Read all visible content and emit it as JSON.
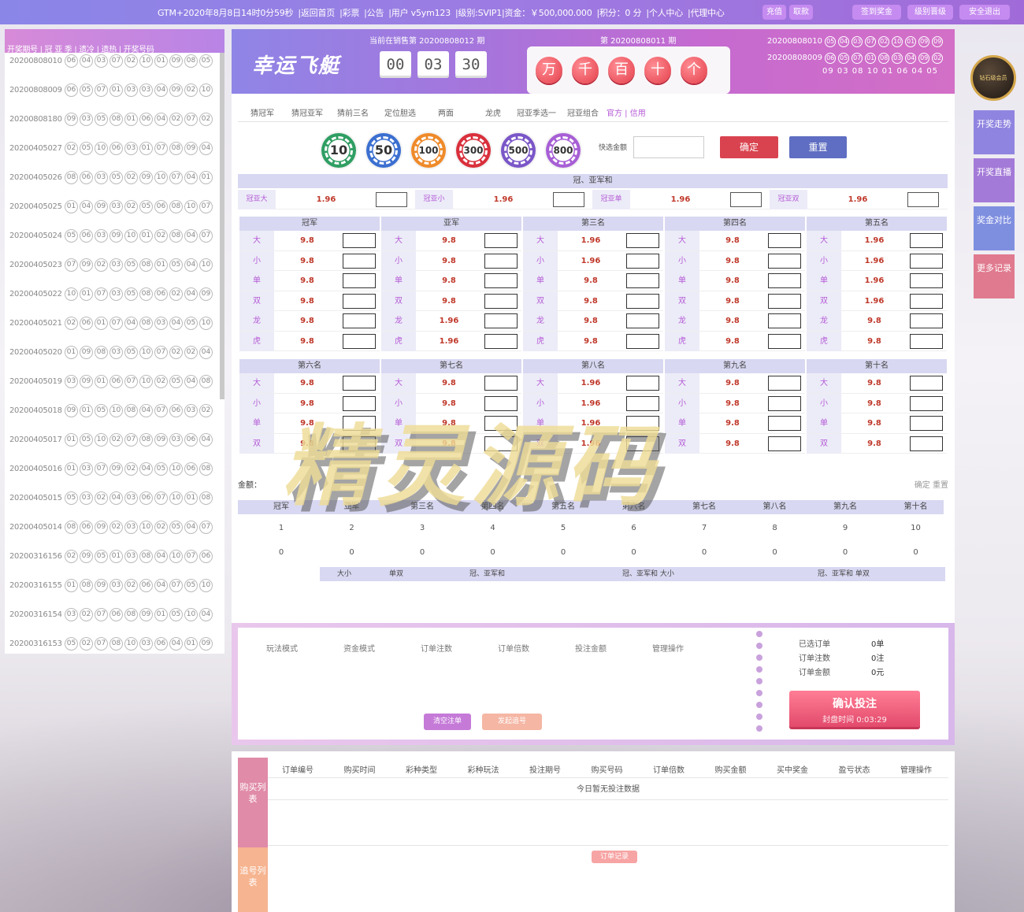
{
  "topbar": {
    "info": [
      "GTM+2020年8月8日14时0分59秒",
      "|返回首页",
      "|彩票",
      "|公告",
      "|用户 v5ym123",
      "|级别:SVIP1|资金：￥500,000.000",
      "|积分：0 分",
      "|个人中心",
      "|代理中心"
    ],
    "recharge": "充值",
    "withdraw": "取款",
    "btn_sign": "签到奖金",
    "btn_rank": "级别晋级",
    "btn_logout": "安全退出"
  },
  "left": {
    "header": "开奖期号 | 冠  亚  季 | 遗冷 | 遗热 |     开奖号码",
    "rows": [
      {
        "issue": "20200808010",
        "nums": [
          "06",
          "04",
          "03",
          "07",
          "02",
          "10",
          "01",
          "09",
          "08",
          "05"
        ]
      },
      {
        "issue": "20200808009",
        "nums": [
          "06",
          "05",
          "07",
          "01",
          "03",
          "03",
          "04",
          "09",
          "02",
          "10"
        ]
      },
      {
        "issue": "20200808180",
        "nums": [
          "09",
          "03",
          "05",
          "08",
          "01",
          "06",
          "04",
          "02",
          "07",
          "02"
        ]
      },
      {
        "issue": "20200405027",
        "nums": [
          "02",
          "05",
          "10",
          "06",
          "03",
          "01",
          "07",
          "08",
          "09",
          "04"
        ]
      },
      {
        "issue": "20200405026",
        "nums": [
          "08",
          "06",
          "03",
          "05",
          "02",
          "09",
          "10",
          "07",
          "04",
          "01"
        ]
      },
      {
        "issue": "20200405025",
        "nums": [
          "01",
          "04",
          "09",
          "03",
          "02",
          "05",
          "06",
          "08",
          "10",
          "07"
        ]
      },
      {
        "issue": "20200405024",
        "nums": [
          "05",
          "06",
          "03",
          "09",
          "10",
          "01",
          "02",
          "08",
          "04",
          "07"
        ]
      },
      {
        "issue": "20200405023",
        "nums": [
          "07",
          "09",
          "02",
          "03",
          "05",
          "08",
          "01",
          "05",
          "04",
          "10"
        ]
      },
      {
        "issue": "20200405022",
        "nums": [
          "10",
          "01",
          "07",
          "03",
          "05",
          "08",
          "06",
          "02",
          "04",
          "09"
        ]
      },
      {
        "issue": "20200405021",
        "nums": [
          "02",
          "06",
          "01",
          "07",
          "04",
          "08",
          "03",
          "04",
          "05",
          "10"
        ]
      },
      {
        "issue": "20200405020",
        "nums": [
          "01",
          "09",
          "08",
          "03",
          "05",
          "10",
          "07",
          "02",
          "02",
          "04"
        ]
      },
      {
        "issue": "20200405019",
        "nums": [
          "03",
          "09",
          "01",
          "06",
          "07",
          "10",
          "02",
          "05",
          "04",
          "08"
        ]
      },
      {
        "issue": "20200405018",
        "nums": [
          "09",
          "01",
          "05",
          "10",
          "08",
          "04",
          "07",
          "06",
          "03",
          "02"
        ]
      },
      {
        "issue": "20200405017",
        "nums": [
          "01",
          "05",
          "10",
          "02",
          "07",
          "08",
          "09",
          "03",
          "06",
          "04"
        ]
      },
      {
        "issue": "20200405016",
        "nums": [
          "01",
          "03",
          "07",
          "09",
          "02",
          "04",
          "05",
          "10",
          "06",
          "08"
        ]
      },
      {
        "issue": "20200405015",
        "nums": [
          "05",
          "03",
          "02",
          "04",
          "03",
          "06",
          "07",
          "10",
          "01",
          "08"
        ]
      },
      {
        "issue": "20200405014",
        "nums": [
          "08",
          "06",
          "09",
          "02",
          "03",
          "10",
          "02",
          "05",
          "04",
          "07"
        ]
      },
      {
        "issue": "20200316156",
        "nums": [
          "02",
          "09",
          "05",
          "01",
          "03",
          "08",
          "04",
          "10",
          "07",
          "06"
        ]
      },
      {
        "issue": "20200316155",
        "nums": [
          "01",
          "08",
          "09",
          "03",
          "02",
          "06",
          "04",
          "07",
          "05",
          "10"
        ]
      },
      {
        "issue": "20200316154",
        "nums": [
          "03",
          "02",
          "07",
          "06",
          "08",
          "09",
          "01",
          "05",
          "10",
          "04"
        ]
      },
      {
        "issue": "20200316153",
        "nums": [
          "05",
          "02",
          "07",
          "08",
          "10",
          "03",
          "06",
          "04",
          "01",
          "09"
        ]
      }
    ]
  },
  "banner": {
    "logo": "幸运飞艇",
    "current_title": "当前在销售第 20200808012 期",
    "timer": [
      "00",
      "03",
      "30"
    ],
    "last_title": "第 20200808011 期",
    "digits": [
      "万",
      "千",
      "百",
      "十",
      "个"
    ],
    "recent": [
      {
        "issue": "20200808010",
        "nums": [
          "05",
          "04",
          "03",
          "07",
          "02",
          "10",
          "01",
          "09",
          "09"
        ]
      },
      {
        "issue": "20200808009",
        "nums": [
          "06",
          "05",
          "07",
          "01",
          "08",
          "03",
          "04",
          "09",
          "02"
        ]
      }
    ],
    "tail": "09 03 08 10 01 06 04 05"
  },
  "tabs": [
    "猜冠军",
    "猜冠亚军",
    "猜前三名",
    "定位胆选",
    "两面",
    "龙虎",
    "冠亚季选一",
    "冠亚组合",
    "官方 | 信用"
  ],
  "chips": [
    {
      "label": "10",
      "color": "#2f9e63"
    },
    {
      "label": "50",
      "color": "#3b6fd0"
    },
    {
      "label": "100",
      "color": "#ef8a2a"
    },
    {
      "label": "300",
      "color": "#d9303c"
    },
    {
      "label": "500",
      "color": "#7a56c8"
    },
    {
      "label": "800",
      "color": "#a75fd5"
    }
  ],
  "quick": {
    "label": "快选金额",
    "ok": "确定",
    "reset": "重置"
  },
  "sum": {
    "title": "冠、亚军和",
    "cells": [
      {
        "name": "冠亚大",
        "odds": "1.96"
      },
      {
        "name": "冠亚小",
        "odds": "1.96"
      },
      {
        "name": "冠亚单",
        "odds": "1.96"
      },
      {
        "name": "冠亚双",
        "odds": "1.96"
      }
    ]
  },
  "blocks_top": [
    {
      "title": "冠军",
      "rows": [
        [
          "大",
          "9.8"
        ],
        [
          "小",
          "9.8"
        ],
        [
          "单",
          "9.8"
        ],
        [
          "双",
          "9.8"
        ],
        [
          "龙",
          "9.8"
        ],
        [
          "虎",
          "9.8"
        ]
      ]
    },
    {
      "title": "亚军",
      "rows": [
        [
          "大",
          "9.8"
        ],
        [
          "小",
          "9.8"
        ],
        [
          "单",
          "9.8"
        ],
        [
          "双",
          "9.8"
        ],
        [
          "龙",
          "1.96"
        ],
        [
          "虎",
          "1.96"
        ]
      ]
    },
    {
      "title": "第三名",
      "rows": [
        [
          "大",
          "1.96"
        ],
        [
          "小",
          "1.96"
        ],
        [
          "单",
          "9.8"
        ],
        [
          "双",
          "9.8"
        ],
        [
          "龙",
          "9.8"
        ],
        [
          "虎",
          "9.8"
        ]
      ]
    },
    {
      "title": "第四名",
      "rows": [
        [
          "大",
          "9.8"
        ],
        [
          "小",
          "9.8"
        ],
        [
          "单",
          "9.8"
        ],
        [
          "双",
          "9.8"
        ],
        [
          "龙",
          "9.8"
        ],
        [
          "虎",
          "9.8"
        ]
      ]
    },
    {
      "title": "第五名",
      "rows": [
        [
          "大",
          "1.96"
        ],
        [
          "小",
          "1.96"
        ],
        [
          "单",
          "1.96"
        ],
        [
          "双",
          "1.96"
        ],
        [
          "龙",
          "9.8"
        ],
        [
          "虎",
          "9.8"
        ]
      ]
    }
  ],
  "blocks_bottom": [
    {
      "title": "第六名",
      "rows": [
        [
          "大",
          "9.8"
        ],
        [
          "小",
          "9.8"
        ],
        [
          "单",
          "9.8"
        ],
        [
          "双",
          "9.8"
        ]
      ]
    },
    {
      "title": "第七名",
      "rows": [
        [
          "大",
          "9.8"
        ],
        [
          "小",
          "9.8"
        ],
        [
          "单",
          "9.8"
        ],
        [
          "双",
          "9.8"
        ]
      ]
    },
    {
      "title": "第八名",
      "rows": [
        [
          "大",
          "1.96"
        ],
        [
          "小",
          "1.96"
        ],
        [
          "单",
          "1.96"
        ],
        [
          "双",
          "1.96"
        ]
      ]
    },
    {
      "title": "第九名",
      "rows": [
        [
          "大",
          "9.8"
        ],
        [
          "小",
          "9.8"
        ],
        [
          "单",
          "9.8"
        ],
        [
          "双",
          "9.8"
        ]
      ]
    },
    {
      "title": "第十名",
      "rows": [
        [
          "大",
          "9.8"
        ],
        [
          "小",
          "9.8"
        ],
        [
          "单",
          "9.8"
        ],
        [
          "双",
          "9.8"
        ]
      ]
    }
  ],
  "amount": {
    "label": "金额：",
    "right": "确定 重置"
  },
  "positions": {
    "headers": [
      "冠军",
      "亚军",
      "第三名",
      "第四名",
      "第五名",
      "第六名",
      "第七名",
      "第八名",
      "第九名",
      "第十名"
    ],
    "nums": [
      "1",
      "2",
      "3",
      "4",
      "5",
      "6",
      "7",
      "8",
      "9",
      "10"
    ],
    "zeros": [
      "0",
      "0",
      "0",
      "0",
      "0",
      "0",
      "0",
      "0",
      "0",
      "0"
    ]
  },
  "subhead": [
    "大小",
    "单双",
    "冠、亚军和",
    "冠、亚军和 大小",
    "冠、亚军和 单双"
  ],
  "order": {
    "cols": [
      "玩法模式",
      "资金模式",
      "订单注数",
      "订单倍数",
      "投注金额",
      "管理操作"
    ],
    "stats": [
      {
        "label": "已选订单",
        "value": "0单"
      },
      {
        "label": "订单注数",
        "value": "0注"
      },
      {
        "label": "订单金额",
        "value": "0元"
      }
    ],
    "confirm": "确认投注",
    "closing": "封盘时间 0:03:29",
    "clear_btn": "清空注单",
    "continue_btn": "发起追号"
  },
  "list": {
    "side1": "购买列表",
    "side2": "追号列表",
    "headers": [
      "订单编号",
      "购买时间",
      "彩种类型",
      "彩种玩法",
      "投注期号",
      "购买号码",
      "订单倍数",
      "购买金额",
      "买中奖金",
      "盈亏状态",
      "管理操作"
    ],
    "empty": "今日暂无投注数据",
    "record_btn": "订单记录"
  },
  "right": [
    {
      "label": "开奖走势",
      "color": "#8f85e0"
    },
    {
      "label": "开奖直播",
      "color": "#a47ad8"
    },
    {
      "label": "奖金对比",
      "color": "#7f8fe0"
    },
    {
      "label": "更多记录",
      "color": "#e07a8f"
    }
  ],
  "badge": "钻石级会员",
  "watermark": "精灵源码"
}
